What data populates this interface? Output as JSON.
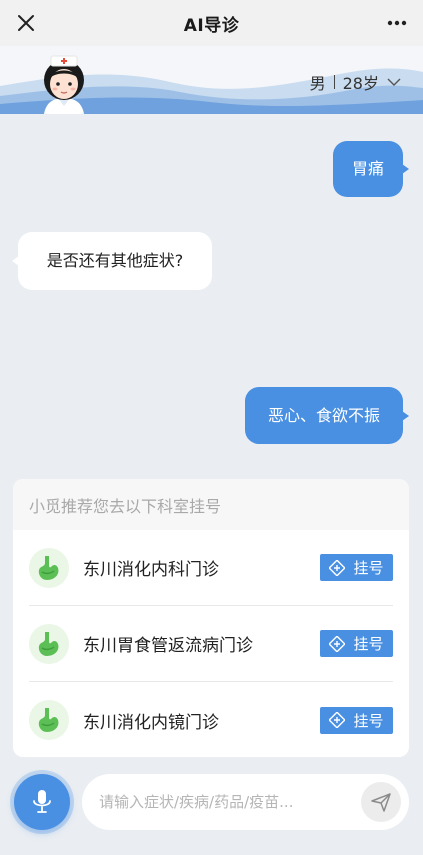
{
  "header": {
    "title": "AI导诊"
  },
  "profile": {
    "gender": "男",
    "age": "28岁"
  },
  "messages": [
    {
      "from": "user",
      "text": "胃痛"
    },
    {
      "from": "bot",
      "text": "是否还有其他症状?"
    },
    {
      "from": "user",
      "text": "恶心、食欲不振"
    }
  ],
  "recommendation": {
    "header": "小觅推荐您去以下科室挂号",
    "departments": [
      {
        "name": "东川消化内科门诊",
        "button": "挂号"
      },
      {
        "name": "东川胃食管返流病门诊",
        "button": "挂号"
      },
      {
        "name": "东川消化内镜门诊",
        "button": "挂号"
      }
    ]
  },
  "input": {
    "placeholder": "请输入症状/疾病/药品/疫苗..."
  },
  "colors": {
    "accent": "#4a90e2",
    "background": "#eaeef2",
    "icon_green": "#5bbf55"
  },
  "icons": [
    "close-icon",
    "more-icon",
    "chevron-down-icon",
    "stomach-icon",
    "register-icon",
    "microphone-icon",
    "send-icon"
  ]
}
